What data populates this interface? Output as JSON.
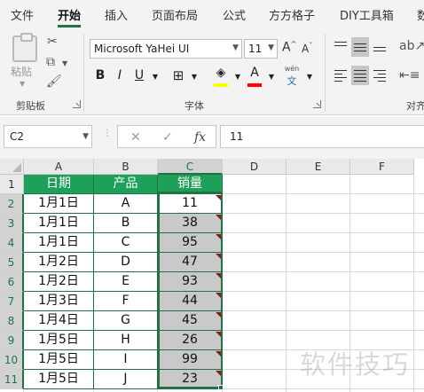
{
  "tabs": [
    "文件",
    "开始",
    "插入",
    "页面布局",
    "公式",
    "方方格子",
    "DIY工具箱",
    "数"
  ],
  "active_tab": "开始",
  "ribbon": {
    "clipboard": {
      "paste_label": "粘贴",
      "group_label": "剪贴板"
    },
    "font": {
      "name": "Microsoft YaHei UI",
      "size": "11",
      "grow": "A",
      "shrink": "A",
      "bold": "B",
      "italic": "I",
      "underline": "U",
      "font_color_letter": "A",
      "phonetic_top": "wén",
      "phonetic_bottom": "文",
      "group_label": "字体",
      "highlight_color": "#ffff00",
      "font_color": "#ff0000"
    },
    "alignment": {
      "group_label": "对齐"
    }
  },
  "formula_bar": {
    "cell_ref": "C2",
    "fx": "fx",
    "value": "11"
  },
  "sheet": {
    "columns": [
      "A",
      "B",
      "C",
      "D",
      "E",
      "F"
    ],
    "rows": [
      "1",
      "2",
      "3",
      "4",
      "5",
      "6",
      "7",
      "8",
      "9",
      "10",
      "11"
    ],
    "headers": [
      "日期",
      "产品",
      "销量"
    ],
    "data": [
      [
        "1月1日",
        "A",
        "11"
      ],
      [
        "1月1日",
        "B",
        "38"
      ],
      [
        "1月1日",
        "C",
        "95"
      ],
      [
        "1月2日",
        "D",
        "47"
      ],
      [
        "1月2日",
        "E",
        "93"
      ],
      [
        "1月3日",
        "F",
        "44"
      ],
      [
        "1月4日",
        "G",
        "45"
      ],
      [
        "1月5日",
        "H",
        "26"
      ],
      [
        "1月5日",
        "I",
        "99"
      ],
      [
        "1月5日",
        "J",
        "23"
      ]
    ],
    "selected_cell": "C2",
    "header_fill": "#1fa05a",
    "selection_color": "#217346"
  },
  "watermark": "软件技巧"
}
